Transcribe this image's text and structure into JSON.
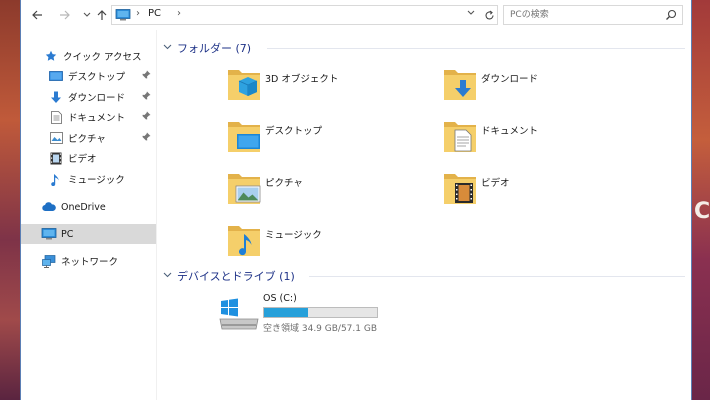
{
  "address_bar": {
    "location": "PC",
    "search_placeholder": "PCの検索"
  },
  "nav_pane": {
    "quick_access": "クイック アクセス",
    "pinned": [
      {
        "label": "デスクトップ",
        "icon": "desktop-icon"
      },
      {
        "label": "ダウンロード",
        "icon": "download-icon"
      },
      {
        "label": "ドキュメント",
        "icon": "document-icon"
      },
      {
        "label": "ピクチャ",
        "icon": "pictures-icon"
      }
    ],
    "unpinned": [
      {
        "label": "ビデオ",
        "icon": "video-icon"
      },
      {
        "label": "ミュージック",
        "icon": "music-icon"
      }
    ],
    "onedrive": "OneDrive",
    "pc": "PC",
    "network": "ネットワーク"
  },
  "folders_group": {
    "header": "フォルダー (7)",
    "items": [
      {
        "label": "3D オブジェクト",
        "icon": "3d-objects-folder-icon"
      },
      {
        "label": "ダウンロード",
        "icon": "downloads-folder-icon"
      },
      {
        "label": "デスクトップ",
        "icon": "desktop-folder-icon"
      },
      {
        "label": "ドキュメント",
        "icon": "documents-folder-icon"
      },
      {
        "label": "ピクチャ",
        "icon": "pictures-folder-icon"
      },
      {
        "label": "ビデオ",
        "icon": "videos-folder-icon"
      },
      {
        "label": "ミュージック",
        "icon": "music-folder-icon"
      }
    ]
  },
  "drives_group": {
    "header": "デバイスとドライブ (1)",
    "drive": {
      "name": "OS (C:)",
      "free_text": "空き領域 34.9 GB/57.1 GB",
      "used_fraction": 0.39,
      "bar_color": "#26a0da"
    }
  },
  "wallpaper": {
    "edge_text": "CH"
  },
  "colors": {
    "group_header": "#1e3287",
    "selected_bg": "#d9d9d9",
    "accent_blue": "#26a0da"
  }
}
